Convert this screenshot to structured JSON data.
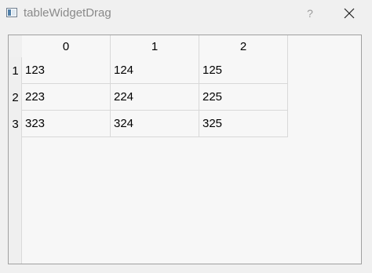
{
  "window": {
    "title": "tableWidgetDrag",
    "help_label": "?"
  },
  "table": {
    "column_headers": [
      "0",
      "1",
      "2"
    ],
    "row_headers": [
      "1",
      "2",
      "3"
    ],
    "rows": [
      [
        "123",
        "124",
        "125"
      ],
      [
        "223",
        "224",
        "225"
      ],
      [
        "323",
        "324",
        "325"
      ]
    ]
  }
}
